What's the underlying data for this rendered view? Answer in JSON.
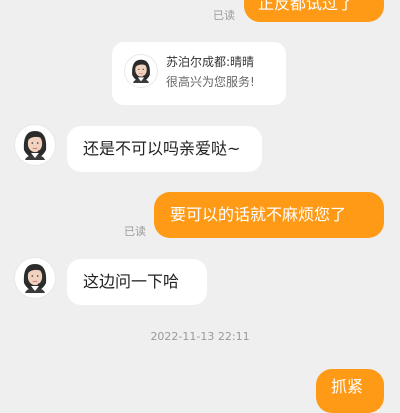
{
  "chat": {
    "messages": [
      {
        "text": "正反都试过了",
        "status": "已读"
      },
      {
        "welcome_name": "苏泊尔成都:晴晴",
        "welcome_text": "很高兴为您服务!"
      },
      {
        "text": "还是不可以吗亲爱哒~"
      },
      {
        "text": "要可以的话就不麻烦您了",
        "status": "已读"
      },
      {
        "text": "这边问一下哈"
      },
      {
        "timestamp": "2022-11-13 22:11"
      },
      {
        "text": "抓紧"
      }
    ]
  },
  "colors": {
    "background": "#efefef",
    "outgoing_bubble": "#ff9a16",
    "incoming_bubble": "#ffffff",
    "timestamp_text": "#9a9a9a",
    "read_text": "#9b9b9b"
  },
  "icons": {
    "agent_avatar": "customer-service-agent-avatar"
  }
}
